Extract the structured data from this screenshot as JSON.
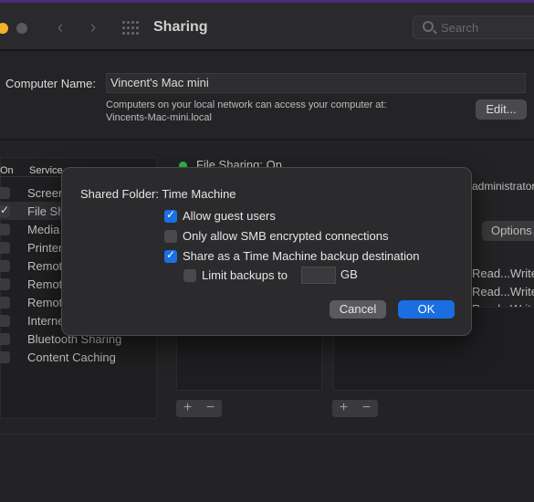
{
  "window": {
    "title": "Sharing",
    "search_placeholder": "Search"
  },
  "computer_name": {
    "label": "Computer Name:",
    "value": "Vincent's Mac mini",
    "description_line1": "Computers on your local network can access your computer at:",
    "description_line2": "Vincents-Mac-mini.local",
    "edit_label": "Edit..."
  },
  "services": {
    "header_on": "On",
    "header_service": "Service",
    "items": [
      {
        "label": "Screen Sharing",
        "checked": false
      },
      {
        "label": "File Sharing",
        "checked": true
      },
      {
        "label": "Media Sharing",
        "checked": false
      },
      {
        "label": "Printer Sharing",
        "checked": false
      },
      {
        "label": "Remote Login",
        "checked": false
      },
      {
        "label": "Remote Management",
        "checked": false
      },
      {
        "label": "Remote Apple Events",
        "checked": false
      },
      {
        "label": "Internet Sharing",
        "checked": false
      },
      {
        "label": "Bluetooth Sharing",
        "checked": false
      },
      {
        "label": "Content Caching",
        "checked": false
      }
    ]
  },
  "detail": {
    "status": "File Sharing: On",
    "admin_text": "administrator",
    "options_label": "Options",
    "permissions": [
      "Read...Write",
      "Read...Write",
      "Read...Write"
    ],
    "plus": "+",
    "minus": "−"
  },
  "dialog": {
    "title": "Shared Folder: Time Machine",
    "options": [
      {
        "label": "Allow guest users",
        "checked": true
      },
      {
        "label": "Only allow SMB encrypted connections",
        "checked": false
      },
      {
        "label": "Share as a Time Machine backup destination",
        "checked": true
      },
      {
        "label": "Limit backups to",
        "checked": false
      }
    ],
    "limit_value": "",
    "unit": "GB",
    "cancel_label": "Cancel",
    "ok_label": "OK"
  },
  "colors": {
    "accent": "#1a6ee0",
    "status_on": "#2ec14a"
  }
}
